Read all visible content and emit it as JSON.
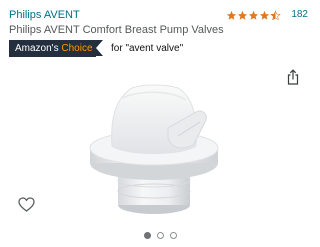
{
  "product": {
    "brand": "Philips AVENT",
    "title": "Philips AVENT Comfort Breast Pump Valves",
    "rating": {
      "stars": 4.5,
      "max_stars": 5,
      "count": "182",
      "color": "#de7921"
    },
    "badge": {
      "prefix": "Amazon's",
      "highlight": "Choice",
      "query": "for \"avent valve\""
    },
    "image_icon": "white-silicone-duckbill-valve"
  },
  "actions": {
    "share_icon": "share-icon",
    "wishlist_icon": "heart-icon"
  },
  "gallery": {
    "image_count": 3,
    "active_index": 0
  },
  "colors": {
    "link": "#007185",
    "badge_bg": "#232f3e",
    "badge_accent": "#ff9900",
    "text_secondary": "#565959"
  }
}
